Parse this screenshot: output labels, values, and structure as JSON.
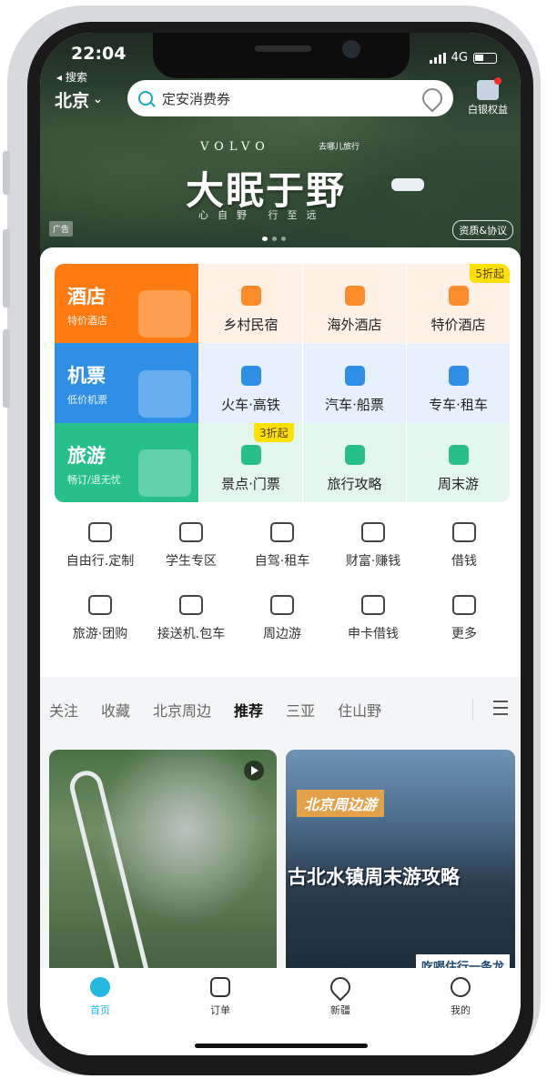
{
  "status": {
    "time": "22:04",
    "back_label": "◂ 搜索",
    "network": "4G"
  },
  "header": {
    "city": "北京",
    "search_placeholder": "定安消费券",
    "member_label": "白银权益"
  },
  "banner": {
    "brand": "VOLVO",
    "partner": "去哪儿旅行",
    "slogan": "大眠于野",
    "sub_slogan": "心自野 行至远",
    "ad_label": "广告",
    "qualification": "资质&协议"
  },
  "grid": {
    "hotel": {
      "title": "酒店",
      "subtitle": "特价酒店",
      "items": [
        "乡村民宿",
        "海外酒店",
        "特价酒店"
      ],
      "promo": "5折起"
    },
    "flight": {
      "title": "机票",
      "subtitle": "低价机票",
      "items": [
        "火车·高铁",
        "汽车·船票",
        "专车·租车"
      ]
    },
    "tour": {
      "title": "旅游",
      "subtitle": "畅订/退无忧",
      "items": [
        "景点·门票",
        "旅行攻略",
        "周末游"
      ],
      "promo": "3折起"
    }
  },
  "services": [
    [
      "自由行.定制",
      "学生专区",
      "自驾·租车",
      "财富·赚钱",
      "借钱"
    ],
    [
      "旅游·团购",
      "接送机.包车",
      "周边游",
      "申卡借钱",
      "更多"
    ]
  ],
  "tabs": [
    "关注",
    "收藏",
    "北京周边",
    "推荐",
    "三亚",
    "住山野"
  ],
  "feed": {
    "right_tag": "北京周边游",
    "right_title": "古北水镇周末游攻略",
    "right_sub": "吃喝住行一条龙"
  },
  "nav": [
    "首页",
    "订单",
    "新疆",
    "我的"
  ],
  "colors": {
    "accent": "#22b8e0",
    "hotel": "#ff7a10",
    "flight": "#2f8ee6",
    "tour": "#27c08b",
    "promo": "#ffe100"
  }
}
